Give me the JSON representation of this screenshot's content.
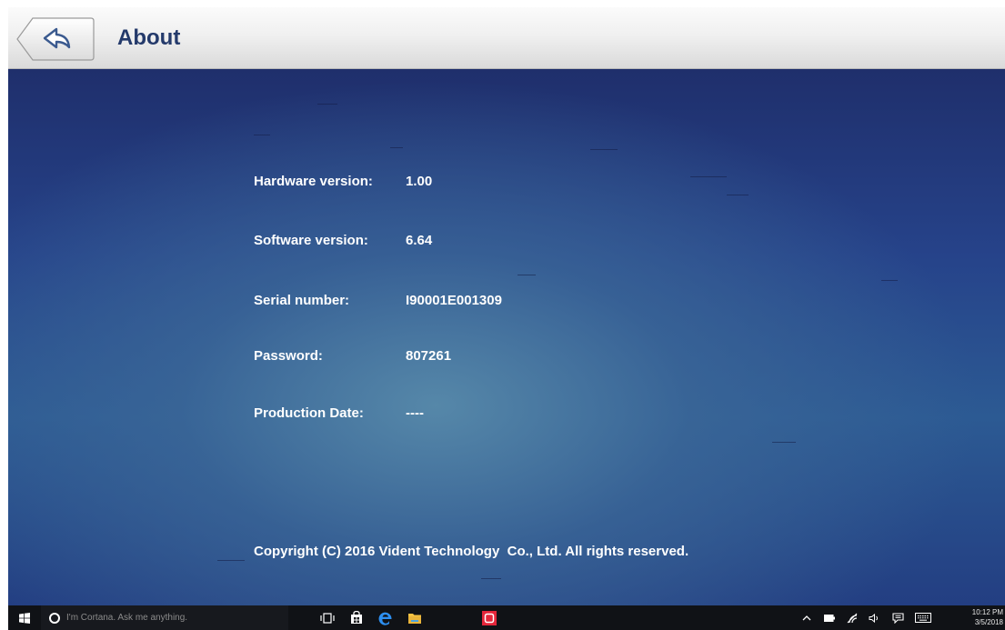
{
  "header": {
    "title": "About"
  },
  "info": [
    {
      "label": "Hardware version:",
      "value": "1.00"
    },
    {
      "label": "Software version:",
      "value": "6.64"
    },
    {
      "label": "Serial number:",
      "value": "I90001E001309"
    },
    {
      "label": "Password:",
      "value": "807261"
    },
    {
      "label": "Production Date:",
      "value": "----"
    }
  ],
  "footer": {
    "copyright": "Copyright (C) 2016 Vident Technology  Co., Ltd. All rights reserved."
  },
  "taskbar": {
    "cortana_placeholder": "I'm Cortana. Ask me anything.",
    "time": "10:12 PM",
    "date": "3/5/2018",
    "pinned": [
      "task-view-icon",
      "store-icon",
      "edge-icon",
      "file-explorer-icon",
      "app-icon"
    ],
    "tray": [
      "chevron-up-icon",
      "battery-icon",
      "network-icon",
      "volume-icon",
      "action-center-icon",
      "keyboard-icon"
    ]
  },
  "colors": {
    "title": "#243a6b",
    "background": "#2c5a93",
    "text": "#ffffff",
    "taskbar": "#101216"
  }
}
